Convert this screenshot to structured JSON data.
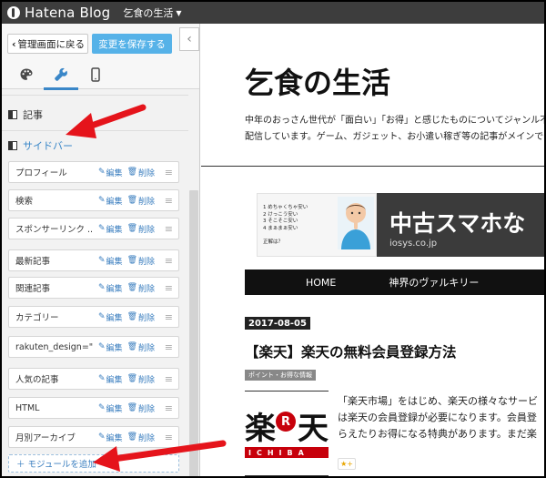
{
  "topbar": {
    "logo_text": "Hatena Blog",
    "blog_name": "乞食の生活"
  },
  "sidebar": {
    "back_label": "管理画面に戻る",
    "save_label": "変更を保存する",
    "collapse_label": "‹",
    "tabs": [
      {
        "icon": "palette-icon",
        "active": false
      },
      {
        "icon": "wrench-icon",
        "active": true
      },
      {
        "icon": "smartphone-icon",
        "active": false
      }
    ],
    "sections": {
      "article_label": "記事",
      "sidebar_label": "サイドバー"
    },
    "edit_label": "編集",
    "delete_label": "削除",
    "modules": [
      "プロフィール",
      "検索",
      "スポンサーリンク ...",
      "最新記事",
      "関連記事",
      "カテゴリー",
      "rakuten_design=\"...",
      "人気の記事",
      "HTML",
      "月別アーカイブ"
    ],
    "add_module_label": "＋ モジュールを追加"
  },
  "preview": {
    "blog_title": "乞食の生活",
    "description_lines": [
      "中年のおっさん世代が「面白い」「お得」と感じたものについてジャンル不",
      "配信しています。ゲーム、ガジェット、お小遣い稼ぎ等の記事がメインで"
    ],
    "ad": {
      "list_lines": [
        "1 めちゃくちゃ安い",
        "2 けっこう安い",
        "3 そこそこ安い",
        "4 まぁまぁ安い",
        "",
        "正解は？"
      ],
      "main_text": "中古スマホな",
      "url": "iosys.co.jp"
    },
    "nav": [
      "HOME",
      "神界のヴァルキリー"
    ],
    "post": {
      "date": "2017-08-05",
      "title": "【楽天】楽天の無料会員登録方法",
      "category": "ポイント・お得な情報",
      "thumb_chars": [
        "楽",
        "R",
        "天"
      ],
      "thumb_band": "ICHIBA",
      "excerpt_lines": [
        "「楽天市場」をはじめ、楽天の様々なサービ",
        "は楽天の会員登録が必要になります。会員登",
        "らえたりお得になる特典があります。まだ楽"
      ],
      "star_label": "★+"
    }
  },
  "colors": {
    "accent": "#3a87c8",
    "save_button": "#56b2e8",
    "arrow": "#e5141b",
    "rakuten_red": "#c7000b"
  }
}
